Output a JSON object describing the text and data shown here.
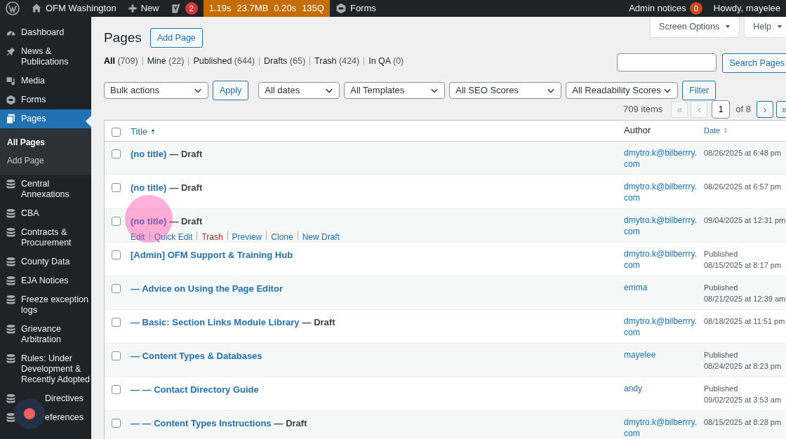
{
  "admin_bar": {
    "site": "OFM Washington",
    "new": "New",
    "seo_count": "2",
    "perf": [
      "1.19s",
      "23.7MB",
      "0.20s",
      "135Q"
    ],
    "forms": "Forms",
    "notices": "Admin notices",
    "notices_count": "0",
    "greeting": "Howdy, mayelee"
  },
  "sidebar": {
    "items": [
      {
        "label": "Dashboard",
        "kind": "dashboard",
        "selected": false
      },
      {
        "label": "News & Publications",
        "kind": "pin",
        "selected": false
      },
      {
        "label": "Media",
        "kind": "media",
        "selected": false
      },
      {
        "label": "Forms",
        "kind": "forms",
        "selected": false
      },
      {
        "label": "Pages",
        "kind": "pages",
        "selected": true,
        "children": [
          {
            "label": "All Pages",
            "selected": true
          },
          {
            "label": "Add Page",
            "selected": false
          }
        ]
      },
      {
        "label": "Central Annexations",
        "kind": "database",
        "selected": false
      },
      {
        "label": "CBA",
        "kind": "database",
        "selected": false
      },
      {
        "label": "Contracts & Procurement",
        "kind": "database",
        "selected": false
      },
      {
        "label": "County Data",
        "kind": "database",
        "selected": false
      },
      {
        "label": "EJA Notices",
        "kind": "database",
        "selected": false
      },
      {
        "label": "Freeze exception logs",
        "kind": "database",
        "selected": false
      },
      {
        "label": "Grievance Arbitration",
        "kind": "database",
        "selected": false
      },
      {
        "label": "Rules: Under Development & Recently Adopted",
        "kind": "database",
        "selected": false
      },
      {
        "label": "Directives",
        "kind": "database",
        "selected": false,
        "partly_covered": true
      },
      {
        "label": "eferences",
        "kind": "database",
        "selected": false,
        "partly_covered": true
      }
    ]
  },
  "screen_tabs": [
    "Screen Options",
    "Help"
  ],
  "heading": "Pages",
  "add_button": "Add Page",
  "views": [
    {
      "label": "All",
      "count": "(709)",
      "selected": true
    },
    {
      "label": "Mine",
      "count": "(22)",
      "selected": false
    },
    {
      "label": "Published",
      "count": "(644)",
      "selected": false
    },
    {
      "label": "Drafts",
      "count": "(65)",
      "selected": false
    },
    {
      "label": "Trash",
      "count": "(424)",
      "selected": false
    },
    {
      "label": "In QA",
      "count": "(0)",
      "selected": false
    }
  ],
  "search_button": "Search Pages",
  "bulk_select": "Bulk actions",
  "apply_button": "Apply",
  "filters": [
    "All dates",
    "All Templates",
    "All SEO Scores",
    "All Readability Scores"
  ],
  "filter_button": "Filter",
  "pagination": {
    "items": "709 items",
    "first": {
      "label": "«",
      "disabled": true
    },
    "prev": {
      "label": "‹",
      "disabled": true
    },
    "page": "1",
    "of": "of 8",
    "next": {
      "label": "›",
      "disabled": false
    },
    "last": {
      "label": "»",
      "disabled": false
    }
  },
  "table": {
    "select_all_checked": false,
    "columns": [
      {
        "label": "Title",
        "sortable": true,
        "sorted": true
      },
      {
        "label": "Author",
        "sortable": false
      },
      {
        "label": "Date",
        "sortable": true,
        "sorted": false
      }
    ],
    "rows": [
      {
        "checked": false,
        "title": "(no title)",
        "state": "— Draft",
        "author": "dmytro.k@bilberrry.com",
        "date": "08/26/2025 at 6:48 pm"
      },
      {
        "checked": false,
        "title": "(no title)",
        "state": "— Draft",
        "author": "dmytro.k@bilberrry.com",
        "date": "08/26/2025 at 6:57 pm"
      },
      {
        "checked": false,
        "title": "(no title)",
        "state": "— Draft",
        "author": "dmytro.k@bilberrry.com",
        "date": "09/04/2025 at 12:31 pm",
        "actions": [
          {
            "label": "Edit",
            "kind": "link"
          },
          {
            "label": "Quick Edit",
            "kind": "link"
          },
          {
            "label": "Trash",
            "kind": "delete"
          },
          {
            "label": "Preview",
            "kind": "link"
          },
          {
            "label": "Clone",
            "kind": "link"
          },
          {
            "label": "New Draft",
            "kind": "link"
          }
        ]
      },
      {
        "checked": false,
        "title": "[Admin] OFM Support & Training Hub",
        "author": "dmytro.k@bilberrry.com",
        "status": "Published",
        "date": "08/15/2025 at 8:17 pm"
      },
      {
        "checked": false,
        "title": "— Advice on Using the Page Editor",
        "author": "emma",
        "status": "Published",
        "date": "08/21/2025 at 12:39 am"
      },
      {
        "checked": false,
        "title": "— Basic: Section Links Module Library",
        "state": "— Draft",
        "author": "dmytro.k@bilberrry.com",
        "date": "08/18/2025 at 11:51 pm"
      },
      {
        "checked": false,
        "title": "— Content Types & Databases",
        "author": "mayelee",
        "status": "Published",
        "date": "08/24/2025 at 8:23 pm"
      },
      {
        "checked": false,
        "title": "— — Contact Directory Guide",
        "author": "andy",
        "status": "Published",
        "date": "09/02/2025 at 3:53 am"
      },
      {
        "checked": false,
        "title": "— — Content Types Instructions",
        "state": "— Draft",
        "author": "dmytro.k@bilberrry.com",
        "date": "08/15/2025 at 8:28 pm"
      }
    ]
  }
}
